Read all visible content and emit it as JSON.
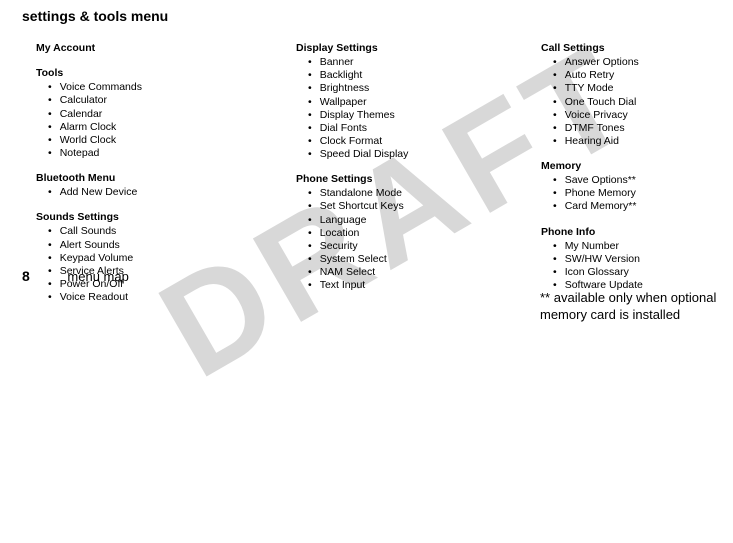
{
  "watermark": "DRAFT",
  "page_title": "settings & tools menu",
  "columns": [
    {
      "sections": [
        {
          "heading": "My Account",
          "items": []
        },
        {
          "heading": "Tools",
          "items": [
            "Voice Commands",
            "Calculator",
            "Calendar",
            "Alarm Clock",
            "World Clock",
            "Notepad"
          ]
        },
        {
          "heading": "Bluetooth Menu",
          "items": [
            "Add New Device"
          ]
        },
        {
          "heading": "Sounds Settings",
          "items": [
            "Call Sounds",
            "Alert Sounds",
            "Keypad Volume",
            "Service Alerts",
            "Power On/Off",
            "Voice Readout"
          ]
        }
      ]
    },
    {
      "sections": [
        {
          "heading": "Display Settings",
          "items": [
            "Banner",
            "Backlight",
            "Brightness",
            "Wallpaper",
            "Display Themes",
            "Dial Fonts",
            "Clock Format",
            "Speed Dial Display"
          ]
        },
        {
          "heading": "Phone Settings",
          "items": [
            "Standalone Mode",
            "Set Shortcut Keys",
            "Language",
            "Location",
            "Security",
            "System Select",
            "NAM Select",
            "Text Input"
          ]
        }
      ]
    },
    {
      "sections": [
        {
          "heading": "Call Settings",
          "items": [
            "Answer Options",
            "Auto Retry",
            "TTY Mode",
            "One Touch Dial",
            "Voice Privacy",
            "DTMF Tones",
            "Hearing Aid"
          ]
        },
        {
          "heading": "Memory",
          "items": [
            "Save Options**",
            "Phone Memory",
            "Card Memory**"
          ]
        },
        {
          "heading": "Phone Info",
          "items": [
            "My Number",
            "SW/HW Version",
            "Icon Glossary",
            "Software Update"
          ]
        }
      ]
    }
  ],
  "footnote": "** available only when optional memory card is installed",
  "footer": {
    "page_number": "8",
    "label": "menu map"
  }
}
